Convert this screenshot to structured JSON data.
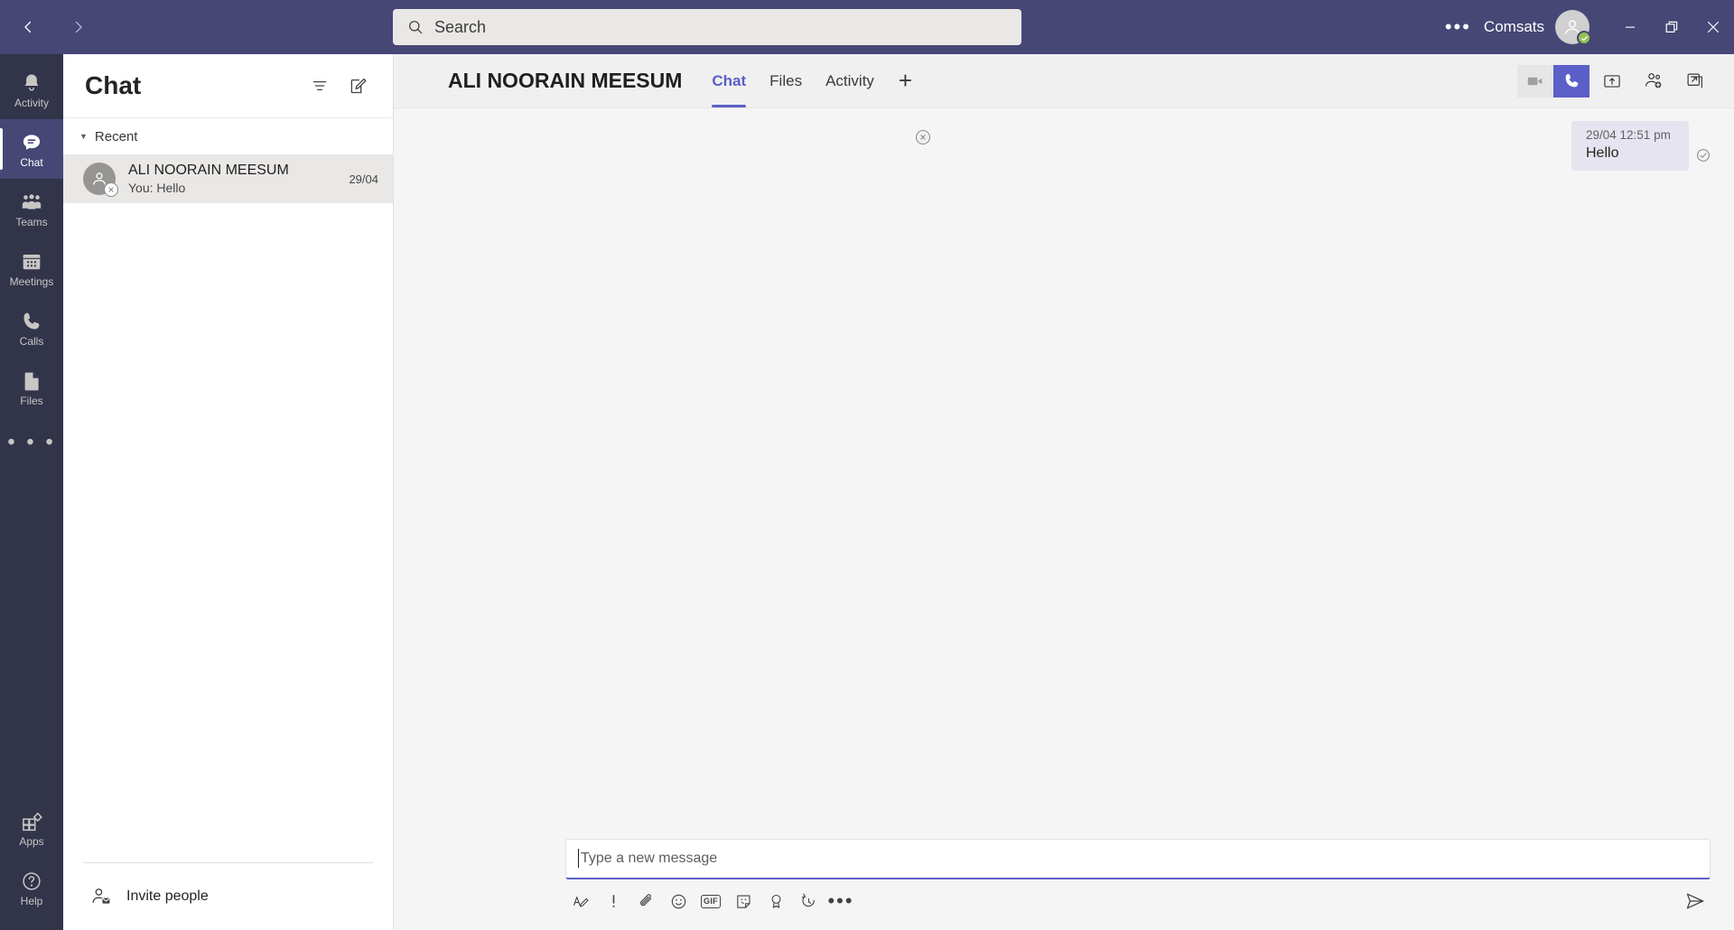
{
  "titlebar": {
    "back_tooltip": "Back",
    "forward_tooltip": "Forward",
    "search_placeholder": "Search",
    "more_label": "•••",
    "org_name": "Comsats",
    "presence": "Available",
    "minimize_label": "Minimize",
    "maximize_label": "Restore",
    "close_label": "Close"
  },
  "rail": {
    "items": [
      {
        "label": "Activity",
        "icon": "bell-icon",
        "active": false
      },
      {
        "label": "Chat",
        "icon": "chat-icon",
        "active": true
      },
      {
        "label": "Teams",
        "icon": "teams-icon",
        "active": false
      },
      {
        "label": "Meetings",
        "icon": "calendar-icon",
        "active": false
      },
      {
        "label": "Calls",
        "icon": "phone-icon",
        "active": false
      },
      {
        "label": "Files",
        "icon": "file-icon",
        "active": false
      }
    ],
    "more_label": "• • •",
    "bottom": [
      {
        "label": "Apps",
        "icon": "apps-icon"
      },
      {
        "label": "Help",
        "icon": "help-icon"
      }
    ]
  },
  "chat_list": {
    "title": "Chat",
    "filter_label": "Filter",
    "compose_label": "New chat",
    "section": {
      "label": "Recent",
      "expanded": true
    },
    "items": [
      {
        "name": "ALI NOORAIN MEESUM",
        "preview": "You: Hello",
        "time": "29/04",
        "presence": "offline",
        "selected": true
      }
    ],
    "invite": {
      "label": "Invite people",
      "icon": "person-add-mail-icon"
    }
  },
  "chat_header": {
    "title": "ALI NOORAIN MEESUM",
    "presence": "offline",
    "tabs": [
      {
        "label": "Chat",
        "active": true
      },
      {
        "label": "Files",
        "active": false
      },
      {
        "label": "Activity",
        "active": false
      }
    ],
    "add_tab_label": "+",
    "actions": [
      {
        "name": "video-call",
        "label": "Video call",
        "state": "disabled"
      },
      {
        "name": "audio-call",
        "label": "Audio call",
        "state": "active"
      },
      {
        "name": "share-screen",
        "label": "Share screen",
        "state": "default"
      },
      {
        "name": "add-people",
        "label": "Add people",
        "state": "default"
      },
      {
        "name": "pop-out",
        "label": "Pop out chat",
        "state": "default"
      }
    ]
  },
  "conversation": {
    "messages": [
      {
        "time": "29/04 12:51 pm",
        "text": "Hello",
        "outgoing": true,
        "status": "sent"
      }
    ]
  },
  "composer": {
    "placeholder": "Type a new message",
    "tools": [
      {
        "name": "format-icon",
        "label": "Format"
      },
      {
        "name": "important-icon",
        "label": "Set delivery options"
      },
      {
        "name": "attach-icon",
        "label": "Attach file"
      },
      {
        "name": "emoji-icon",
        "label": "Emoji"
      },
      {
        "name": "gif-icon",
        "label": "GIF"
      },
      {
        "name": "sticker-icon",
        "label": "Sticker"
      },
      {
        "name": "praise-icon",
        "label": "Praise"
      },
      {
        "name": "loop-icon",
        "label": "Schedule"
      },
      {
        "name": "more-icon",
        "label": "More options"
      }
    ],
    "more_label": "•••",
    "send_label": "Send"
  },
  "colors": {
    "titlebar": "#464775",
    "rail": "#32344A",
    "accent": "#5B5FC7",
    "bubble": "#E5E4F0",
    "available": "#92C353"
  }
}
